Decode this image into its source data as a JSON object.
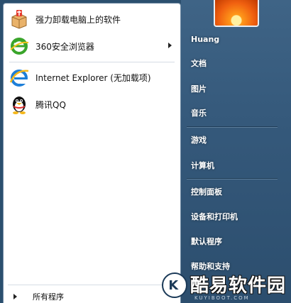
{
  "pinned": [
    {
      "label": "强力卸载电脑上的软件",
      "icon": "uninstall-box-icon"
    },
    {
      "label": "360安全浏览器",
      "icon": "360-browser-icon",
      "has_submenu": true
    },
    {
      "label": "Internet Explorer (无加载项)",
      "icon": "internet-explorer-icon"
    },
    {
      "label": "腾讯QQ",
      "icon": "qq-penguin-icon"
    }
  ],
  "all_programs": "所有程序",
  "right": {
    "user": "Huang",
    "documents": "文档",
    "pictures": "图片",
    "music": "音乐",
    "games": "游戏",
    "computer": "计算机",
    "control_panel": "控制面板",
    "devices_printers": "设备和打印机",
    "default_programs": "默认程序",
    "help_support": "帮助和支持"
  },
  "watermark": {
    "text": "酷易软件园",
    "url": "KUYIBOOT.COM",
    "letter": "K"
  },
  "colors": {
    "right_pane": "#35597b",
    "left_pane": "#ffffff",
    "ie_blue": "#1e7fd8",
    "browser_green": "#3aa52b"
  }
}
